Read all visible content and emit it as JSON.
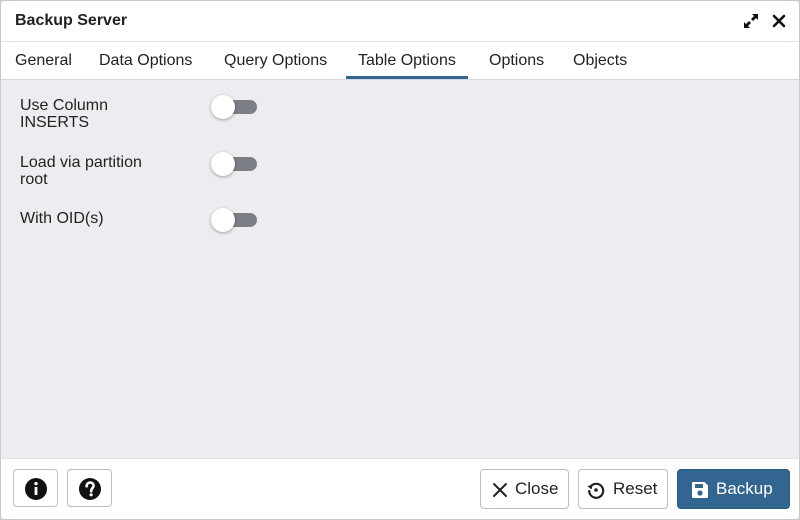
{
  "dialog": {
    "title": "Backup Server",
    "controls": {
      "maximize_icon": "expand-icon",
      "close_icon": "close-icon"
    }
  },
  "tabs": [
    {
      "label": "General",
      "active": false
    },
    {
      "label": "Data Options",
      "active": false
    },
    {
      "label": "Query Options",
      "active": false
    },
    {
      "label": "Table Options",
      "active": true
    },
    {
      "label": "Options",
      "active": false
    },
    {
      "label": "Objects",
      "active": false
    }
  ],
  "form": {
    "rows": [
      {
        "label": "Use Column INSERTS",
        "value": false
      },
      {
        "label": "Load via partition root",
        "value": false
      },
      {
        "label": "With OID(s)",
        "value": false
      }
    ]
  },
  "footer": {
    "info_icon": "info-icon",
    "help_icon": "help-icon",
    "close_label": "Close",
    "reset_label": "Reset",
    "backup_label": "Backup"
  },
  "colors": {
    "accent": "#326690",
    "tab_active_underline": "#326690",
    "toggle_off_track": "#7b7f85",
    "content_bg": "#ebedf0"
  }
}
